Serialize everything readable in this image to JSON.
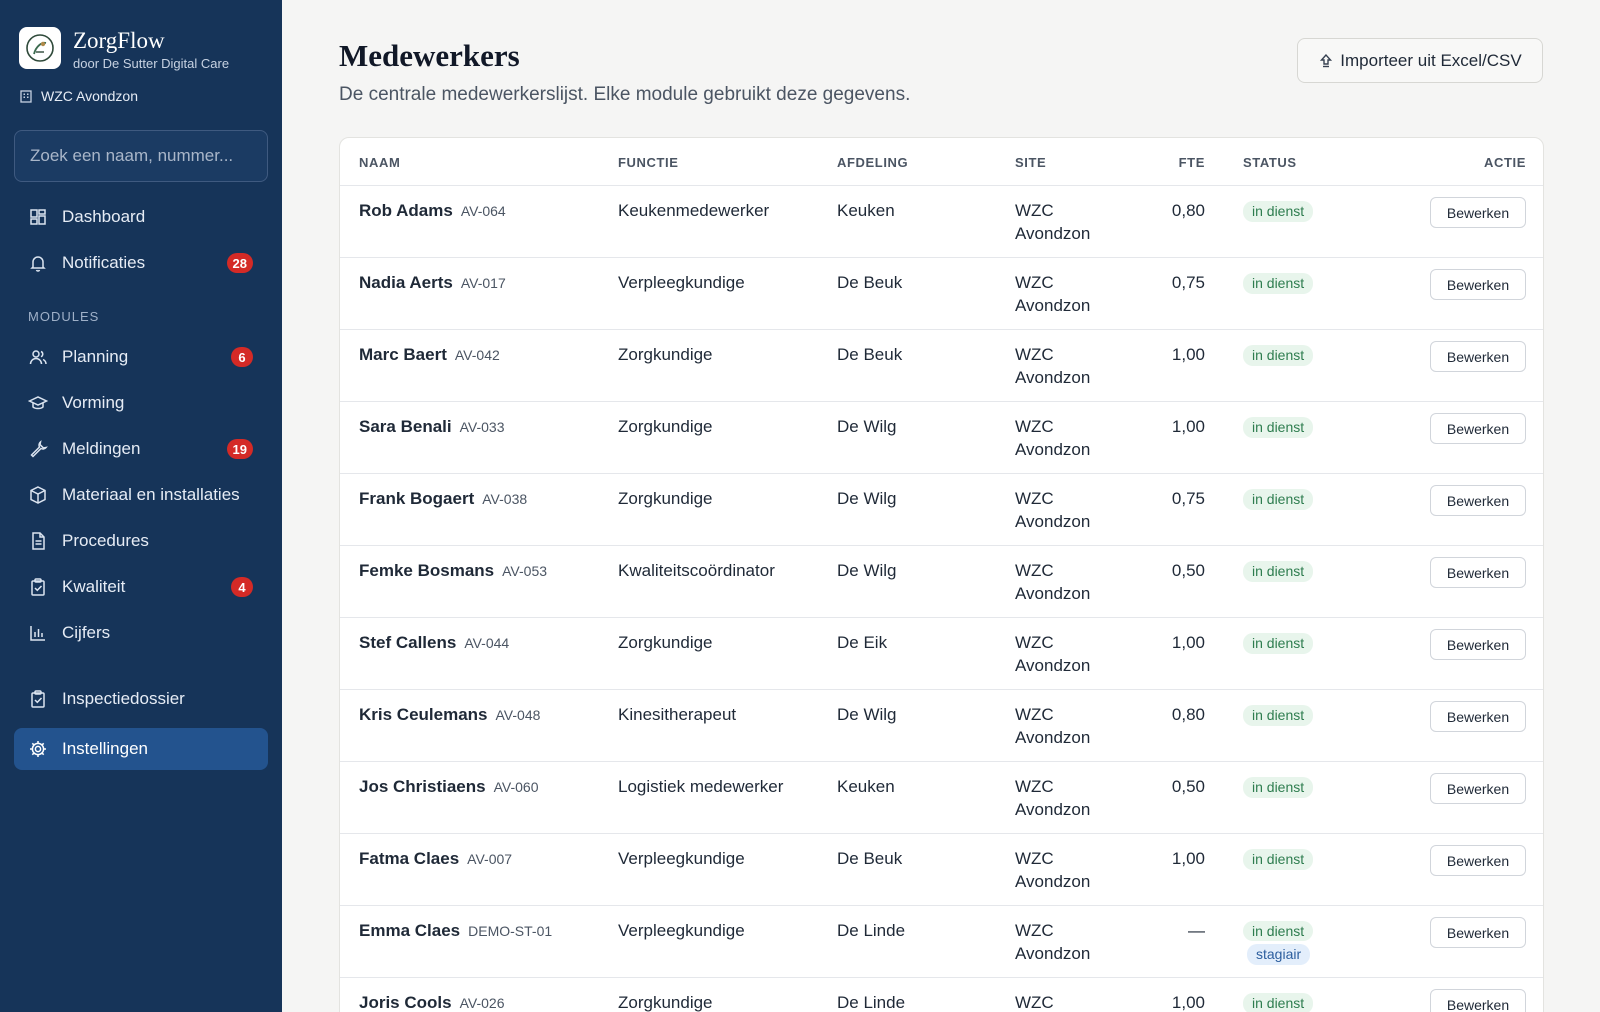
{
  "brand": {
    "name": "ZorgFlow",
    "subtitle": "door De Sutter Digital Care"
  },
  "org": {
    "name": "WZC Avondzon"
  },
  "search": {
    "placeholder": "Zoek een naam, nummer..."
  },
  "nav": {
    "dashboard": {
      "label": "Dashboard",
      "icon": "dashboard-icon"
    },
    "notificaties": {
      "label": "Notificaties",
      "badge": "28",
      "icon": "bell-icon"
    },
    "section_label": "MODULES",
    "planning": {
      "label": "Planning",
      "badge": "6",
      "icon": "users-icon"
    },
    "vorming": {
      "label": "Vorming",
      "icon": "graduation-cap-icon"
    },
    "meldingen": {
      "label": "Meldingen",
      "badge": "19",
      "icon": "wrench-icon"
    },
    "materiaal": {
      "label": "Materiaal en installaties",
      "icon": "box-icon"
    },
    "procedures": {
      "label": "Procedures",
      "icon": "document-icon"
    },
    "kwaliteit": {
      "label": "Kwaliteit",
      "badge": "4",
      "icon": "clipboard-check-icon"
    },
    "cijfers": {
      "label": "Cijfers",
      "icon": "bar-chart-icon"
    },
    "inspectiedossier": {
      "label": "Inspectiedossier",
      "icon": "clipboard-icon"
    },
    "instellingen": {
      "label": "Instellingen",
      "icon": "gear-icon"
    }
  },
  "page": {
    "title": "Medewerkers",
    "subtitle": "De centrale medewerkerslijst. Elke module gebruikt deze gegevens.",
    "import_label": "Importeer uit Excel/CSV"
  },
  "table": {
    "headers": {
      "naam": "NAAM",
      "functie": "FUNCTIE",
      "afdeling": "AFDELING",
      "site": "SITE",
      "fte": "FTE",
      "status": "STATUS",
      "actie": "ACTIE"
    },
    "edit_label": "Bewerken",
    "rows": [
      {
        "name": "Rob Adams",
        "code": "AV-064",
        "functie": "Keukenmedewerker",
        "afdeling": "Keuken",
        "site": "WZC Avondzon",
        "fte": "0,80",
        "status": "in dienst"
      },
      {
        "name": "Nadia Aerts",
        "code": "AV-017",
        "functie": "Verpleegkundige",
        "afdeling": "De Beuk",
        "site": "WZC Avondzon",
        "fte": "0,75",
        "status": "in dienst"
      },
      {
        "name": "Marc Baert",
        "code": "AV-042",
        "functie": "Zorgkundige",
        "afdeling": "De Beuk",
        "site": "WZC Avondzon",
        "fte": "1,00",
        "status": "in dienst"
      },
      {
        "name": "Sara Benali",
        "code": "AV-033",
        "functie": "Zorgkundige",
        "afdeling": "De Wilg",
        "site": "WZC Avondzon",
        "fte": "1,00",
        "status": "in dienst"
      },
      {
        "name": "Frank Bogaert",
        "code": "AV-038",
        "functie": "Zorgkundige",
        "afdeling": "De Wilg",
        "site": "WZC Avondzon",
        "fte": "0,75",
        "status": "in dienst"
      },
      {
        "name": "Femke Bosmans",
        "code": "AV-053",
        "functie": "Kwaliteitscoördinator",
        "afdeling": "De Wilg",
        "site": "WZC Avondzon",
        "fte": "0,50",
        "status": "in dienst"
      },
      {
        "name": "Stef Callens",
        "code": "AV-044",
        "functie": "Zorgkundige",
        "afdeling": "De Eik",
        "site": "WZC Avondzon",
        "fte": "1,00",
        "status": "in dienst"
      },
      {
        "name": "Kris Ceulemans",
        "code": "AV-048",
        "functie": "Kinesitherapeut",
        "afdeling": "De Wilg",
        "site": "WZC Avondzon",
        "fte": "0,80",
        "status": "in dienst"
      },
      {
        "name": "Jos Christiaens",
        "code": "AV-060",
        "functie": "Logistiek medewerker",
        "afdeling": "Keuken",
        "site": "WZC Avondzon",
        "fte": "0,50",
        "status": "in dienst"
      },
      {
        "name": "Fatma Claes",
        "code": "AV-007",
        "functie": "Verpleegkundige",
        "afdeling": "De Beuk",
        "site": "WZC Avondzon",
        "fte": "1,00",
        "status": "in dienst"
      },
      {
        "name": "Emma Claes",
        "code": "DEMO-ST-01",
        "functie": "Verpleegkundige",
        "afdeling": "De Linde",
        "site": "WZC Avondzon",
        "fte": "—",
        "status": "in dienst",
        "tag": "stagiair"
      },
      {
        "name": "Joris Cools",
        "code": "AV-026",
        "functie": "Zorgkundige",
        "afdeling": "De Linde",
        "site": "WZC Avondzon",
        "fte": "1,00",
        "status": "in dienst"
      }
    ]
  }
}
